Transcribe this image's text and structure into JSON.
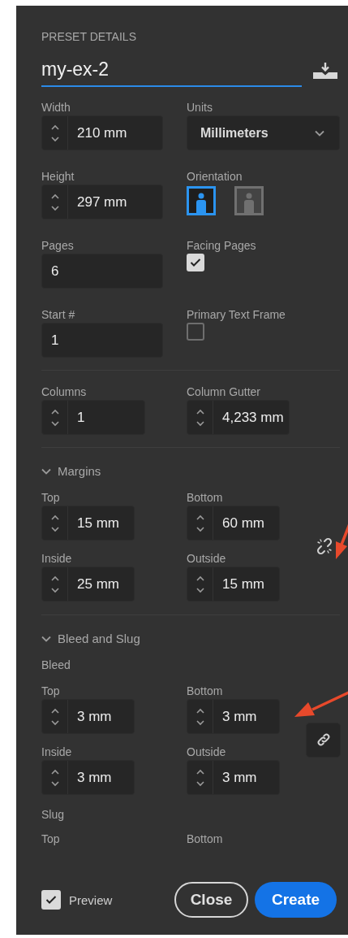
{
  "panel_title": "PRESET DETAILS",
  "preset_name": "my-ex-2",
  "sections": [
    {
      "kind": "general",
      "fields": [
        {
          "kind": "spinner",
          "label": "Width",
          "value": "210 mm"
        },
        {
          "kind": "dropdown",
          "label": "Units",
          "value": "Millimeters"
        },
        {
          "kind": "spinner",
          "label": "Height",
          "value": "297 mm"
        },
        {
          "kind": "orientation",
          "label": "Orientation",
          "options": [
            {
              "selected": true
            },
            {
              "selected": false
            }
          ]
        },
        {
          "kind": "textbox",
          "label": "Pages",
          "value": "6"
        },
        {
          "kind": "checkbox",
          "label": "Facing Pages",
          "checked": true
        },
        {
          "kind": "textbox",
          "label": "Start #",
          "value": "1"
        },
        {
          "kind": "checkbox",
          "label": "Primary Text Frame",
          "checked": false
        }
      ]
    },
    {
      "kind": "columns",
      "fields": [
        {
          "kind": "spinner",
          "label": "Columns",
          "value": "1"
        },
        {
          "kind": "spinner",
          "label": "Column Gutter",
          "value": "4,233 mm"
        }
      ]
    },
    {
      "kind": "margins",
      "title": "Margins",
      "expanded": true,
      "groups": [
        {
          "linked": false,
          "fields": [
            {
              "kind": "spinner",
              "label": "Top",
              "value": "15 mm"
            },
            {
              "kind": "spinner",
              "label": "Bottom",
              "value": "60 mm"
            },
            {
              "kind": "spinner",
              "label": "Inside",
              "value": "25 mm"
            },
            {
              "kind": "spinner",
              "label": "Outside",
              "value": "15 mm"
            }
          ]
        }
      ]
    },
    {
      "kind": "bleed",
      "title": "Bleed and Slug",
      "expanded": true,
      "groups": [
        {
          "title": "Bleed",
          "linked": true,
          "fields": [
            {
              "kind": "spinner",
              "label": "Top",
              "value": "3 mm"
            },
            {
              "kind": "spinner",
              "label": "Bottom",
              "value": "3 mm"
            },
            {
              "kind": "spinner",
              "label": "Inside",
              "value": "3 mm"
            },
            {
              "kind": "spinner",
              "label": "Outside",
              "value": "3 mm"
            }
          ]
        },
        {
          "title": "Slug",
          "fields": [
            {
              "kind": "caption",
              "label": "Top"
            },
            {
              "kind": "caption",
              "label": "Bottom"
            }
          ]
        }
      ]
    }
  ],
  "footer": {
    "preview": {
      "label": "Preview",
      "checked": true
    },
    "buttons": [
      {
        "kind": "secondary",
        "label": "Close"
      },
      {
        "kind": "primary",
        "label": "Create"
      }
    ]
  }
}
